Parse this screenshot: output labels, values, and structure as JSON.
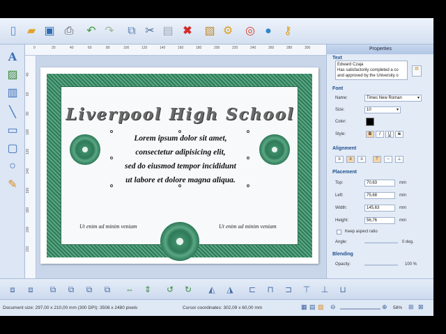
{
  "toolbar": {
    "icons": [
      "new-document-icon",
      "open-folder-icon",
      "save-icon",
      "print-icon",
      "undo-icon",
      "redo-icon",
      "copy-icon",
      "cut-icon",
      "paste-icon",
      "delete-icon",
      "page-setup-icon",
      "settings-gear-icon",
      "help-lifebuoy-icon",
      "web-globe-icon",
      "key-icon"
    ]
  },
  "left_tools": [
    "text-tool-icon",
    "image-tool-icon",
    "barcode-tool-icon",
    "line-tool-icon",
    "rectangle-tool-icon",
    "rounded-rectangle-tool-icon",
    "ellipse-tool-icon",
    "pencil-tool-icon"
  ],
  "ruler": {
    "top_ticks": [
      "0",
      "20",
      "40",
      "60",
      "80",
      "100",
      "120",
      "140",
      "160",
      "180",
      "200",
      "220",
      "240",
      "260",
      "280",
      "300"
    ],
    "left_ticks": [
      "40",
      "60",
      "80",
      "100",
      "120",
      "140",
      "160",
      "180",
      "200",
      "220"
    ]
  },
  "certificate": {
    "title": "Liverpool High School",
    "body_lines": [
      "Lorem ipsum dolor sit amet,",
      "consectetur adipisicing elit,",
      "sed do eiusmod tempor incididunt",
      "ut labore et dolore magna aliqua."
    ],
    "footer_left": "Ut enim ad minim veniam",
    "footer_right": "Ut enim ad minim veniam"
  },
  "properties": {
    "title": "Properties",
    "text_section": "Text",
    "text_line1": "Edward Czaja",
    "text_line2": "Has satisfactorily completed a co",
    "text_line3": "and approved by the University o",
    "font_section": "Font",
    "name_label": "Name:",
    "name_value": "Times New Roman",
    "size_label": "Size:",
    "size_value": "10",
    "color_label": "Color:",
    "style_label": "Style:",
    "style_buttons": [
      "B",
      "I",
      "U",
      "S"
    ],
    "alignment_section": "Alignment",
    "placement_section": "Placement",
    "top_label": "Top:",
    "top_value": "70,63",
    "left_label": "Left:",
    "left_value": "75,68",
    "width_label": "Width:",
    "width_value": "145,63",
    "height_label": "Height:",
    "height_value": "56,76",
    "unit": "mm",
    "keep_aspect": "Keep aspect ratio",
    "angle_label": "Angle:",
    "angle_value": "0 deg.",
    "blending_section": "Blending",
    "opacity_label": "Opacity:",
    "opacity_value": "100 %"
  },
  "bottom_tools": [
    "align-left-edges-icon",
    "align-right-edges-icon",
    "bring-forward-icon",
    "send-backward-icon",
    "bring-to-front-icon",
    "send-to-back-icon",
    "distribute-horizontal-icon",
    "distribute-vertical-icon",
    "rotate-left-icon",
    "rotate-right-icon",
    "flip-horizontal-icon",
    "flip-vertical-icon",
    "align-left-icon",
    "align-center-icon",
    "align-right-icon",
    "align-top-icon",
    "align-middle-icon",
    "align-bottom-icon"
  ],
  "status": {
    "document_size": "Document size: 297,00 x 210,00 mm (300 DPI): 3508 x 2480 pixels",
    "cursor": "Cursor coordinates: 302,09 x 60,00 mm",
    "zoom": "58%"
  },
  "colors": {
    "accent": "#3f8e6b",
    "panel": "#e3ebf7",
    "section": "#1e4e8c"
  }
}
